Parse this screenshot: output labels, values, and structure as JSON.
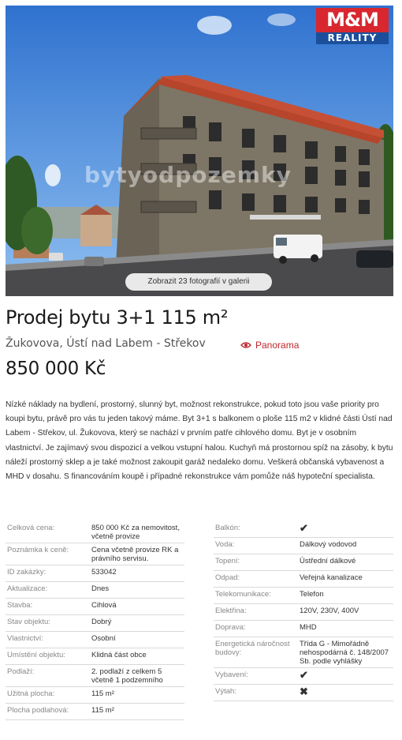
{
  "hero": {
    "logo_top": "M&M",
    "logo_bottom": "REALITY",
    "watermark": "bytyodpozemky",
    "gallery_button": "Zobrazit 23 fotografií v galerii"
  },
  "listing": {
    "title": "Prodej bytu 3+1 115 m²",
    "location": "Žukovova, Ústí nad Labem - Střekov",
    "panorama_label": "Panorama",
    "price": "850 000 Kč",
    "description": "Nízké náklady na bydlení, prostorný, slunný byt, možnost rekonstrukce, pokud toto jsou vaše priority pro koupi bytu, právě pro vás tu jeden takový máme. Byt 3+1 s balkonem o ploše 115 m2 v klidné části Ústí nad Labem - Střekov, ul. Žukovova, který se nachází v prvním patře cihlového domu. Byt je v osobním vlastnictví. Je zajímavý svou dispozicí a velkou vstupní halou. Kuchyň má prostornou spíž na zásoby, k bytu náleží prostorný sklep a je také možnost zakoupit garáž nedaleko domu. Veškerá občanská vybavenost a MHD v dosahu. S financováním koupě i případné rekonstrukce vám pomůže náš hypoteční specialista."
  },
  "params_left": [
    {
      "label": "Celková cena:",
      "value": "850 000 Kč za nemovitost, včetně provize"
    },
    {
      "label": "Poznámka k ceně:",
      "value": "Cena včetně provize RK a právního servisu."
    },
    {
      "label": "ID zakázky:",
      "value": "533042"
    },
    {
      "label": "Aktualizace:",
      "value": "Dnes"
    },
    {
      "label": "Stavba:",
      "value": "Cihlová"
    },
    {
      "label": "Stav objektu:",
      "value": "Dobrý"
    },
    {
      "label": "Vlastnictví:",
      "value": "Osobní"
    },
    {
      "label": "Umístění objektu:",
      "value": "Klidná část obce"
    },
    {
      "label": "Podlaží:",
      "value": "2. podlaží z celkem 5 včetně 1 podzemního"
    },
    {
      "label": "Užitná plocha:",
      "value": "115 m²"
    },
    {
      "label": "Plocha podlahová:",
      "value": "115 m²"
    }
  ],
  "params_right": [
    {
      "label": "Balkón:",
      "value": "",
      "icon": "check-icon"
    },
    {
      "label": "Voda:",
      "value": "Dálkový vodovod"
    },
    {
      "label": "Topení:",
      "value": "Ústřední dálkové"
    },
    {
      "label": "Odpad:",
      "value": "Veřejná kanalizace"
    },
    {
      "label": "Telekomunikace:",
      "value": "Telefon"
    },
    {
      "label": "Elektřina:",
      "value": "120V, 230V, 400V"
    },
    {
      "label": "Doprava:",
      "value": "MHD"
    },
    {
      "label": "Energetická náročnost budovy:",
      "value": "Třída G - Mimořádně nehospodárná č. 148/2007 Sb. podle vyhlášky"
    },
    {
      "label": "Vybavení:",
      "value": "",
      "icon": "check-icon"
    },
    {
      "label": "Výtah:",
      "value": "",
      "icon": "cross-icon"
    }
  ],
  "colors": {
    "accent_red": "#c0272d",
    "check_green": "#2e9a3a",
    "cross_red": "#d32f2f",
    "logo_red": "#d8272f",
    "logo_blue": "#1b4f9c"
  }
}
